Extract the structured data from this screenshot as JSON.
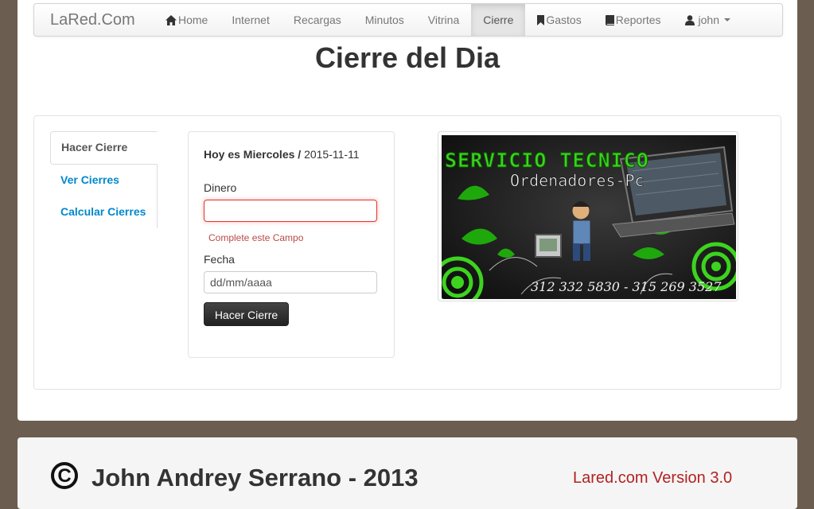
{
  "nav": {
    "brand": "LaRed.Com",
    "items": [
      {
        "label": "Home",
        "icon": "home-icon",
        "active": false
      },
      {
        "label": "Internet",
        "icon": "",
        "active": false
      },
      {
        "label": "Recargas",
        "icon": "",
        "active": false
      },
      {
        "label": "Minutos",
        "icon": "",
        "active": false
      },
      {
        "label": "Vitrina",
        "icon": "",
        "active": false
      },
      {
        "label": "Cierre",
        "icon": "",
        "active": true
      },
      {
        "label": "Gastos",
        "icon": "bookmark-icon",
        "active": false
      },
      {
        "label": "Reportes",
        "icon": "book-icon",
        "active": false
      }
    ],
    "user": {
      "label": "john",
      "icon": "user-icon"
    }
  },
  "page": {
    "title": "Cierre del Dia"
  },
  "sidebar": {
    "tabs": [
      {
        "label": "Hacer Cierre",
        "active": true
      },
      {
        "label": "Ver Cierres",
        "active": false
      },
      {
        "label": "Calcular Cierres",
        "active": false
      }
    ]
  },
  "form": {
    "day_prefix": "Hoy es Miercoles",
    "separator": " / ",
    "date": "2015-11-11",
    "dinero_label": "Dinero",
    "dinero_value": "",
    "dinero_error": "Complete este Campo",
    "fecha_label": "Fecha",
    "fecha_placeholder": "dd/mm/aaaa",
    "submit_label": "Hacer Cierre"
  },
  "banner": {
    "title": "SERVICIO TECNICO",
    "subtitle": "Ordenadores-Pc",
    "phones": "312 332 5830 - 315 269 3527",
    "colors": {
      "green": "#3cd41e",
      "dark": "#111111"
    }
  },
  "footer": {
    "copyright_symbol": "C",
    "author": "John Andrey Serrano - 2013",
    "version": "Lared.com Version 3.0"
  },
  "colors": {
    "background": "#6b5e50",
    "link": "#0088cc",
    "error": "#b94a48",
    "version": "#b22222"
  }
}
